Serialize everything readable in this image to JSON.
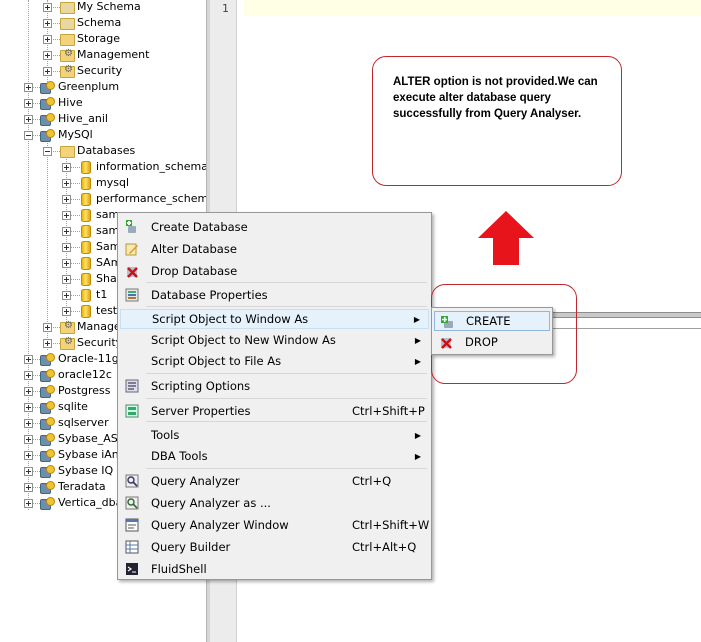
{
  "tree": {
    "items": [
      {
        "label": "My Schema",
        "type": "schema"
      },
      {
        "label": "Schema",
        "type": "schema"
      },
      {
        "label": "Storage",
        "type": "folder"
      },
      {
        "label": "Management",
        "type": "folder-gear"
      },
      {
        "label": "Security",
        "type": "folder-gear"
      },
      {
        "label": "Greenplum",
        "type": "server"
      },
      {
        "label": "Hive",
        "type": "server"
      },
      {
        "label": "Hive_anil",
        "type": "server"
      },
      {
        "label": "MySQl",
        "type": "server"
      },
      {
        "label": "Databases",
        "type": "folder"
      },
      {
        "label": "information_schema",
        "type": "db"
      },
      {
        "label": "mysql",
        "type": "db"
      },
      {
        "label": "performance_schema",
        "type": "db"
      },
      {
        "label": "samp",
        "type": "db"
      },
      {
        "label": "samp",
        "type": "db"
      },
      {
        "label": "Sam",
        "type": "db"
      },
      {
        "label": "SAm",
        "type": "db"
      },
      {
        "label": "Shav",
        "type": "db"
      },
      {
        "label": "t1",
        "type": "db"
      },
      {
        "label": "test",
        "type": "db"
      },
      {
        "label": "Managem",
        "type": "folder-gear"
      },
      {
        "label": "Security",
        "type": "folder-gear"
      },
      {
        "label": "Oracle-11g",
        "type": "server"
      },
      {
        "label": "oracle12c",
        "type": "server"
      },
      {
        "label": "Postgress",
        "type": "server"
      },
      {
        "label": "sqlite",
        "type": "server"
      },
      {
        "label": "sqlserver",
        "type": "server"
      },
      {
        "label": "Sybase_ASE",
        "type": "server"
      },
      {
        "label": "Sybase iAny",
        "type": "server"
      },
      {
        "label": "Sybase IQ",
        "type": "server"
      },
      {
        "label": "Teradata",
        "type": "server"
      },
      {
        "label": "Vertica_dbac",
        "type": "server"
      }
    ]
  },
  "editor": {
    "line_number": "1",
    "highlight_color": "#ffffe5"
  },
  "annotation": {
    "text": "ALTER option is not provided.We can execute alter database query successfully from Query Analyser.",
    "border_color": "#c0272d",
    "arrow_color": "#e8141b"
  },
  "context_menu": {
    "items": [
      {
        "label": "Create Database",
        "icon": "create-database-icon",
        "shortcut": "",
        "submenu": false
      },
      {
        "label": "Alter Database",
        "icon": "alter-database-icon",
        "shortcut": "",
        "submenu": false
      },
      {
        "label": "Drop Database",
        "icon": "drop-database-icon",
        "shortcut": "",
        "submenu": false
      },
      {
        "label": "Database Properties",
        "icon": "database-properties-icon",
        "shortcut": "",
        "submenu": false
      },
      {
        "label": "Script Object to Window As",
        "icon": "",
        "shortcut": "",
        "submenu": true
      },
      {
        "label": "Script Object to New Window As",
        "icon": "",
        "shortcut": "",
        "submenu": true
      },
      {
        "label": "Script Object to File As",
        "icon": "",
        "shortcut": "",
        "submenu": true
      },
      {
        "label": "Scripting Options",
        "icon": "scripting-options-icon",
        "shortcut": "",
        "submenu": false
      },
      {
        "label": "Server Properties",
        "icon": "server-properties-icon",
        "shortcut": "Ctrl+Shift+P",
        "submenu": false
      },
      {
        "label": "Tools",
        "icon": "",
        "shortcut": "",
        "submenu": true
      },
      {
        "label": "DBA Tools",
        "icon": "",
        "shortcut": "",
        "submenu": true
      },
      {
        "label": "Query Analyzer",
        "icon": "query-analyzer-icon",
        "shortcut": "Ctrl+Q",
        "submenu": false
      },
      {
        "label": "Query Analyzer as ...",
        "icon": "query-analyzer-as-icon",
        "shortcut": "",
        "submenu": false
      },
      {
        "label": "Query Analyzer Window",
        "icon": "query-analyzer-window-icon",
        "shortcut": "Ctrl+Shift+W",
        "submenu": false
      },
      {
        "label": "Query Builder",
        "icon": "query-builder-icon",
        "shortcut": "Ctrl+Alt+Q",
        "submenu": false
      },
      {
        "label": "FluidShell",
        "icon": "fluidshell-icon",
        "shortcut": "",
        "submenu": false
      }
    ],
    "highlighted_index": 4
  },
  "submenu": {
    "items": [
      {
        "label": "CREATE",
        "icon": "create-icon"
      },
      {
        "label": "DROP",
        "icon": "drop-icon"
      }
    ],
    "highlighted_index": 0
  }
}
